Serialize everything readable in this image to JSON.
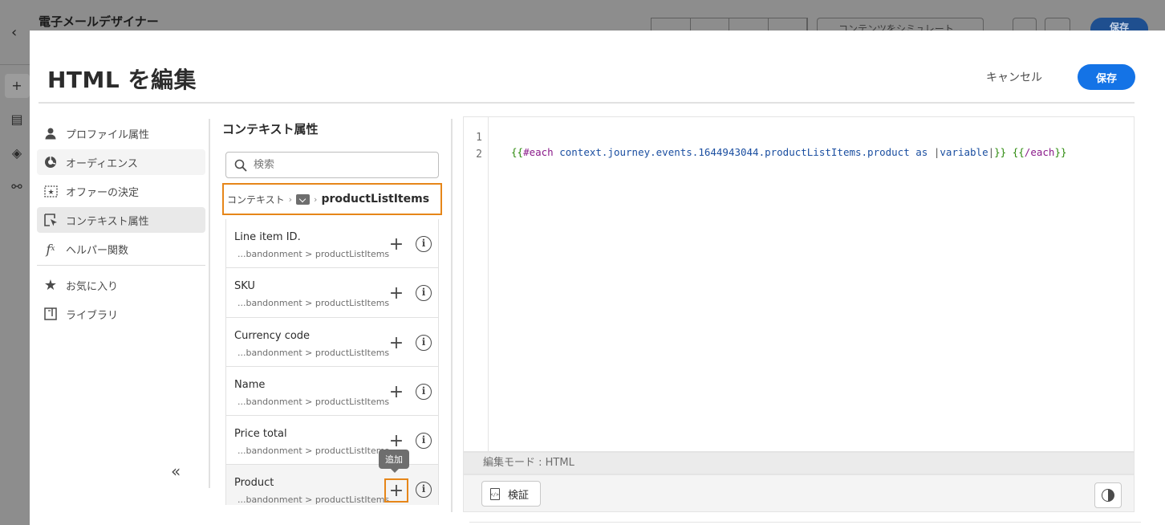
{
  "background": {
    "app_title": "電子メールデザイナー",
    "simulate_label": "コンテンツをシミュレート",
    "save_label": "保存"
  },
  "modal": {
    "title": "HTML を編集",
    "cancel_label": "キャンセル",
    "save_label": "保存"
  },
  "nav": {
    "items": [
      {
        "label": "プロファイル属性",
        "icon": "user-icon"
      },
      {
        "label": "オーディエンス",
        "icon": "audience-icon"
      },
      {
        "label": "オファーの決定",
        "icon": "offer-decision-icon"
      },
      {
        "label": "コンテキスト属性",
        "icon": "contextual-attributes-icon"
      },
      {
        "label": "ヘルパー関数",
        "icon": "function-icon"
      }
    ],
    "secondary": [
      {
        "label": "お気に入り",
        "icon": "star-icon"
      },
      {
        "label": "ライブラリ",
        "icon": "library-icon"
      }
    ],
    "collapse_label": "«"
  },
  "middle": {
    "title": "コンテキスト属性",
    "search_placeholder": "検索",
    "breadcrumb": {
      "root": "コンテキスト",
      "current": "productListItems"
    },
    "items": [
      {
        "name": "Line item ID.",
        "path": "...bandonment > productListItems"
      },
      {
        "name": "SKU",
        "path": "...bandonment > productListItems"
      },
      {
        "name": "Currency code",
        "path": "...bandonment > productListItems"
      },
      {
        "name": "Name",
        "path": "...bandonment > productListItems"
      },
      {
        "name": "Price total",
        "path": "...bandonment > productListItems"
      },
      {
        "name": "Product",
        "path": "...bandonment > productListItems"
      }
    ],
    "tooltip": "追加"
  },
  "editor": {
    "line_numbers": [
      "1",
      "2"
    ],
    "code": {
      "open": "{{",
      "each_kw": "#each",
      "path": "context.journey.events.1644943044.productListItems.product",
      "as_kw": "as",
      "bar_open": "|",
      "var": "variable",
      "bar_close": "|",
      "close": "}}",
      "end_open": "{{",
      "end_kw": "/each",
      "end_close": "}}"
    },
    "mode_label": "編集モード : HTML",
    "validate_label": "検証"
  },
  "colors": {
    "accent": "#1473e6",
    "highlight": "#e68619",
    "brace": "#2d8a0d",
    "keyword": "#8a1a8a",
    "path": "#1a4ea0"
  }
}
